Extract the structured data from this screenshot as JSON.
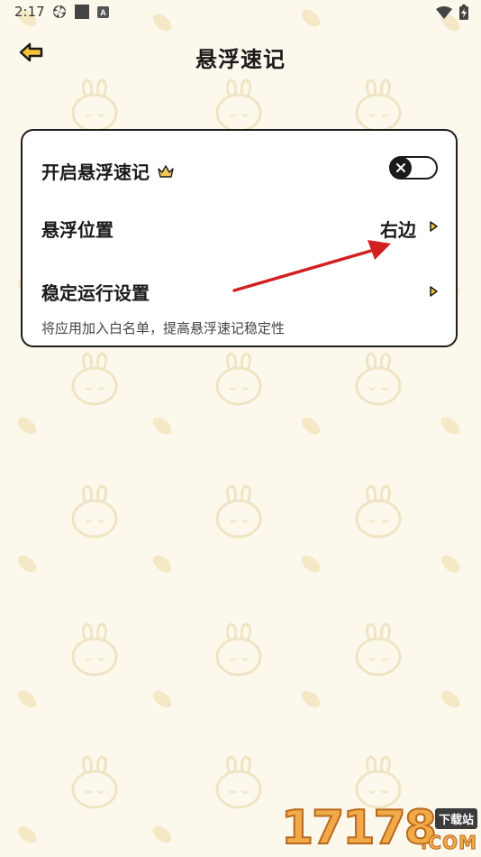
{
  "status_bar": {
    "time": "2:17",
    "left_icons": [
      "aperture-icon",
      "square-icon",
      "a-badge-icon"
    ],
    "right_icons": [
      "wifi-icon",
      "battery-charging-icon"
    ]
  },
  "header": {
    "title": "悬浮速记",
    "back_icon": "back-arrow-icon"
  },
  "settings": {
    "enable": {
      "label": "开启悬浮速记",
      "badge_icon": "crown-icon",
      "toggle_state": "off",
      "toggle_icon": "close-icon"
    },
    "position": {
      "label": "悬浮位置",
      "value": "右边"
    },
    "stability": {
      "label": "稳定运行设置",
      "description": "将应用加入白名单，提高悬浮速记稳定性"
    }
  },
  "watermark": {
    "number": "17178",
    "tag": "下载站",
    "suffix": ".COM"
  },
  "colors": {
    "background": "#fdf8ec",
    "card_border": "#1e1e1e",
    "accent_arrow": "#d21f1f",
    "crown": "#e4b04a",
    "watermark": "#f2a94a"
  }
}
